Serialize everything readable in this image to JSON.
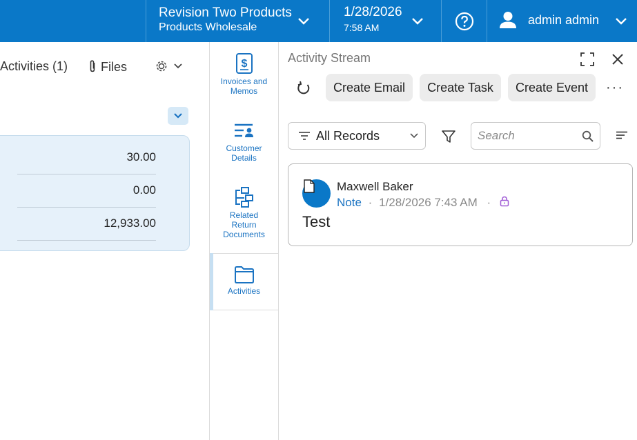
{
  "header": {
    "tenant_name": "Revision Two Products",
    "tenant_sub": "Products Wholesale",
    "date": "1/28/2026",
    "time": "7:58 AM",
    "user_name": "admin admin",
    "help_icon": "help-circle-icon",
    "user_icon": "person-icon"
  },
  "record": {
    "tab_activities": "Activities (1)",
    "tab_files": "Files",
    "totals": [
      "30.00",
      "0.00",
      "12,933.00"
    ]
  },
  "sidenav": {
    "items": [
      {
        "label_1": "Invoices and",
        "label_2": "Memos",
        "icon": "invoice-dollar-icon"
      },
      {
        "label_1": "Customer",
        "label_2": "Details",
        "icon": "customer-details-icon"
      },
      {
        "label_1": "Related",
        "label_2": "Return",
        "label_3": "Documents",
        "icon": "related-documents-icon"
      },
      {
        "label_1": "Activities",
        "icon": "folder-icon",
        "active": true
      }
    ]
  },
  "activity_stream": {
    "title": "Activity Stream",
    "create_email": "Create Email",
    "create_task": "Create Task",
    "create_event": "Create Event",
    "more": "···",
    "filter_select": "All Records",
    "search_placeholder": "Search",
    "entries": [
      {
        "author": "Maxwell Baker",
        "type": "Note",
        "sep1": "·",
        "timestamp": "1/28/2026 7:43 AM",
        "sep2": "·",
        "body": "Test"
      }
    ]
  },
  "colors": {
    "header_bg": "#0a78c8",
    "accent": "#1a73c2",
    "lock_icon": "#a05bd6"
  }
}
